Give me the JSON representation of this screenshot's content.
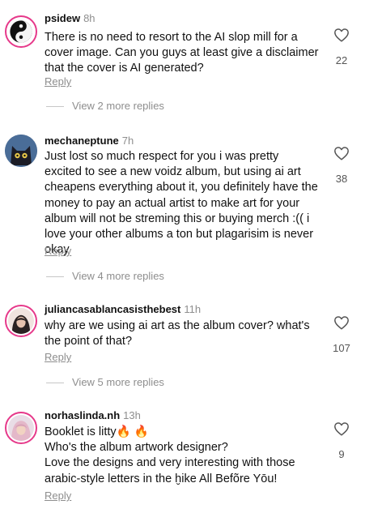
{
  "comments": [
    {
      "username": "psidew",
      "time": "8h",
      "lines": [
        "There is no need to resort to the AI slop mill for a",
        "cover image. Can you guys at least give a disclaimer",
        "that the cover is AI generated?"
      ],
      "likes": "22",
      "reply_label": "Reply",
      "more_replies": "View 2 more replies",
      "avatar_icon": "yin-yang-icon"
    },
    {
      "username": "mechaneptune",
      "time": "7h",
      "lines": [
        "Just lost so much respect for you i was pretty",
        "excited to see a new voidz album, but using ai art",
        "cheapens everything about it, you definitely have the",
        "money to pay an actual artist to make art for your",
        "album will not be streming this or buying merch :(( i",
        "love your other albums a ton but plagarisim is never",
        "okay"
      ],
      "likes": "38",
      "reply_label": "Reply",
      "more_replies": "View 4 more replies",
      "avatar_icon": "cat-avatar"
    },
    {
      "username": "juliancasablancasisthebest",
      "time": "11h",
      "lines": [
        "why are we using ai art as the album cover? what's",
        "the point of that?"
      ],
      "likes": "107",
      "reply_label": "Reply",
      "more_replies": "View 5 more replies",
      "avatar_icon": "photo-avatar"
    },
    {
      "username": "norhaslinda.nh",
      "time": "13h",
      "lines": [
        "Booklet is litty🔥 🔥",
        "Who's the album artwork designer?",
        "Love the designs and very interesting with those",
        "arabic-style letters in the ḫike All Befõre Yōu!"
      ],
      "likes": "9",
      "reply_label": "Reply",
      "avatar_icon": "photo-avatar"
    }
  ],
  "colors": {
    "accent_ring": "#e6398a",
    "muted": "#8e8e8e"
  }
}
